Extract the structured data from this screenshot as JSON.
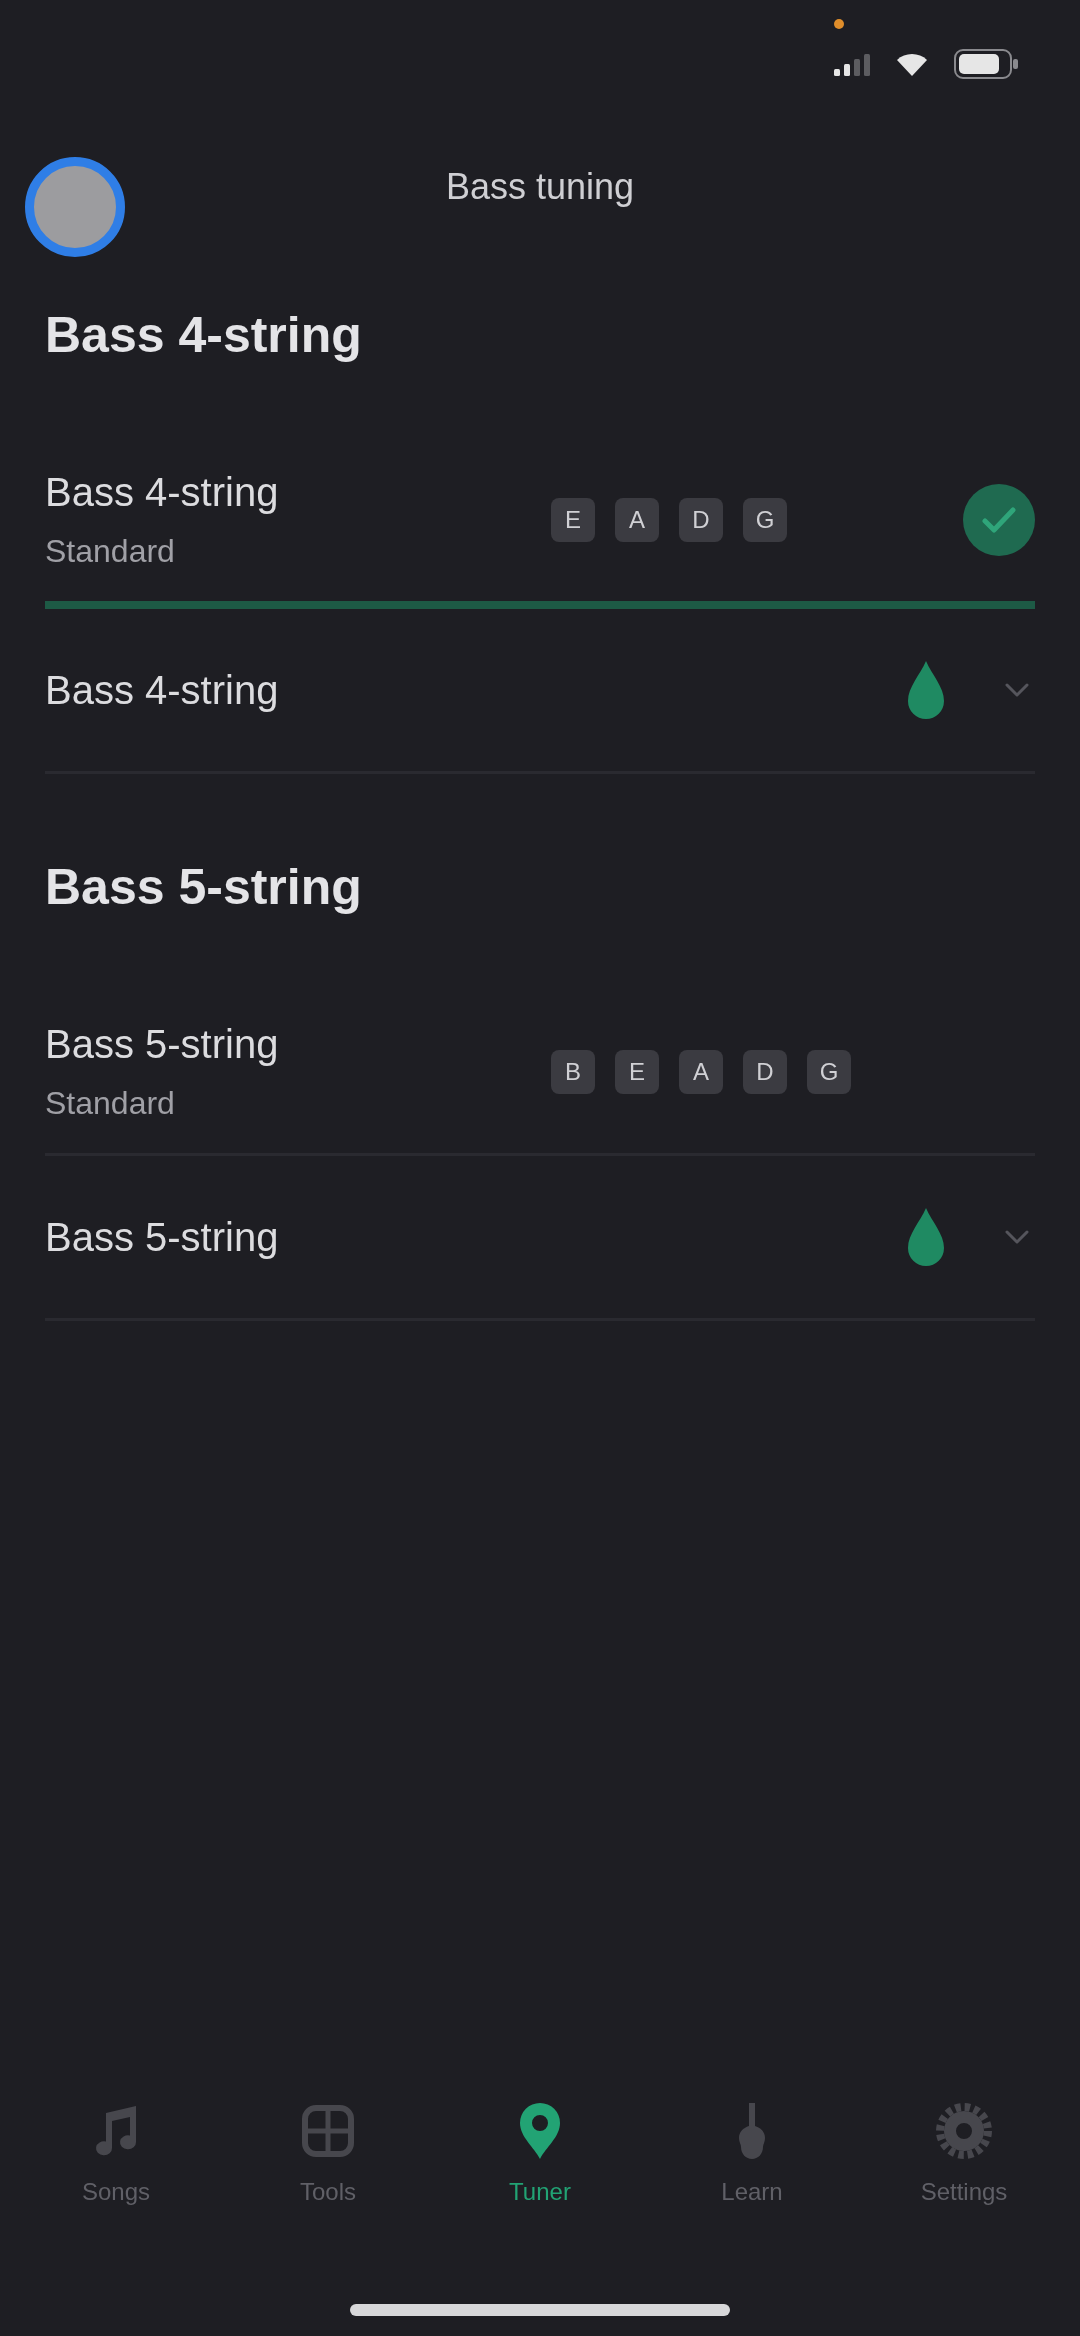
{
  "header": {
    "title": "Bass tuning"
  },
  "sections": [
    {
      "title": "Bass 4-string",
      "items": [
        {
          "kind": "tuning",
          "name": "Bass 4-string",
          "subtitle": "Standard",
          "notes": [
            "E",
            "A",
            "D",
            "G"
          ],
          "selected": true
        },
        {
          "kind": "group",
          "name": "Bass 4-string",
          "expanded": false
        }
      ]
    },
    {
      "title": "Bass 5-string",
      "items": [
        {
          "kind": "tuning",
          "name": "Bass 5-string",
          "subtitle": "Standard",
          "notes": [
            "B",
            "E",
            "A",
            "D",
            "G"
          ],
          "selected": false
        },
        {
          "kind": "group",
          "name": "Bass 5-string",
          "expanded": false
        }
      ]
    }
  ],
  "tab_bar": [
    {
      "label": "Songs",
      "selected": false
    },
    {
      "label": "Tools",
      "selected": false
    },
    {
      "label": "Tuner",
      "selected": true
    },
    {
      "label": "Learn",
      "selected": false
    },
    {
      "label": "Settings",
      "selected": false
    }
  ]
}
